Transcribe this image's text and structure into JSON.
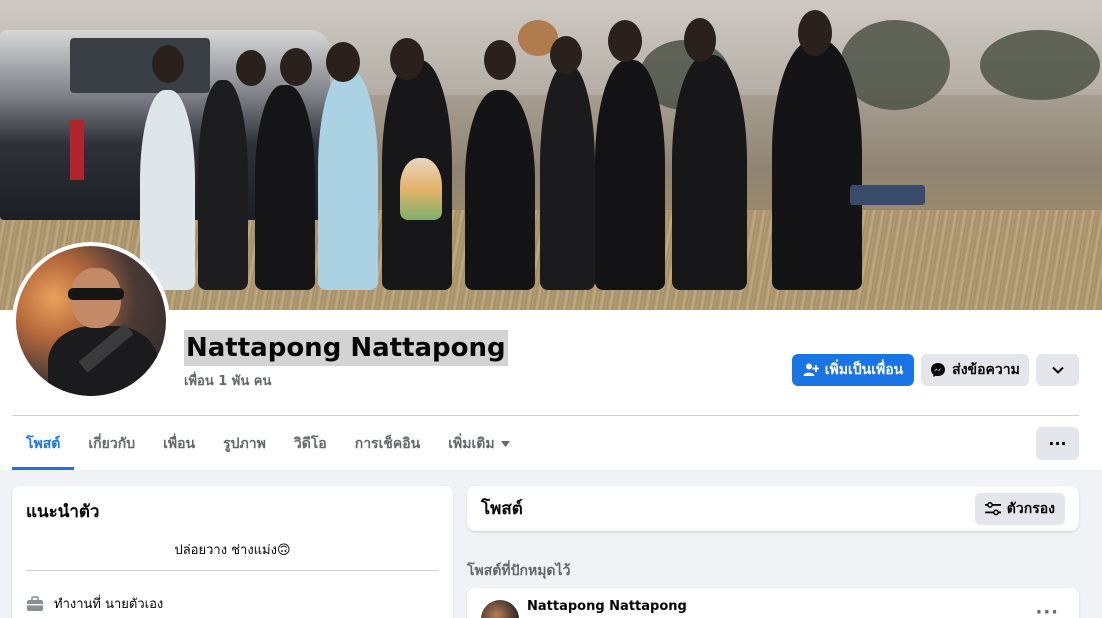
{
  "profile": {
    "name": "Nattapong Nattapong",
    "friends": "เพื่อน 1 พัน คน"
  },
  "actions": {
    "add_friend": "เพิ่มเป็นเพื่อน",
    "message": "ส่งข้อความ"
  },
  "tabs": [
    {
      "label": "โพสต์"
    },
    {
      "label": "เกี่ยวกับ"
    },
    {
      "label": "เพื่อน"
    },
    {
      "label": "รูปภาพ"
    },
    {
      "label": "วิดีโอ"
    },
    {
      "label": "การเช็คอิน"
    },
    {
      "label": "เพิ่มเติม"
    }
  ],
  "intro": {
    "title": "แนะนำตัว",
    "bio": "ปล่อยวาง ช่างแม่ง🙃",
    "work": "ทำงานที่ นายตัวเอง"
  },
  "posts": {
    "title": "โพสต์",
    "filter": "ตัวกรอง",
    "pinned": "โพสต์ที่ปักหมุดไว้",
    "author": "Nattapong Nattapong"
  },
  "colors": {
    "accent": "#1b74e4",
    "background": "#f0f2f5"
  }
}
